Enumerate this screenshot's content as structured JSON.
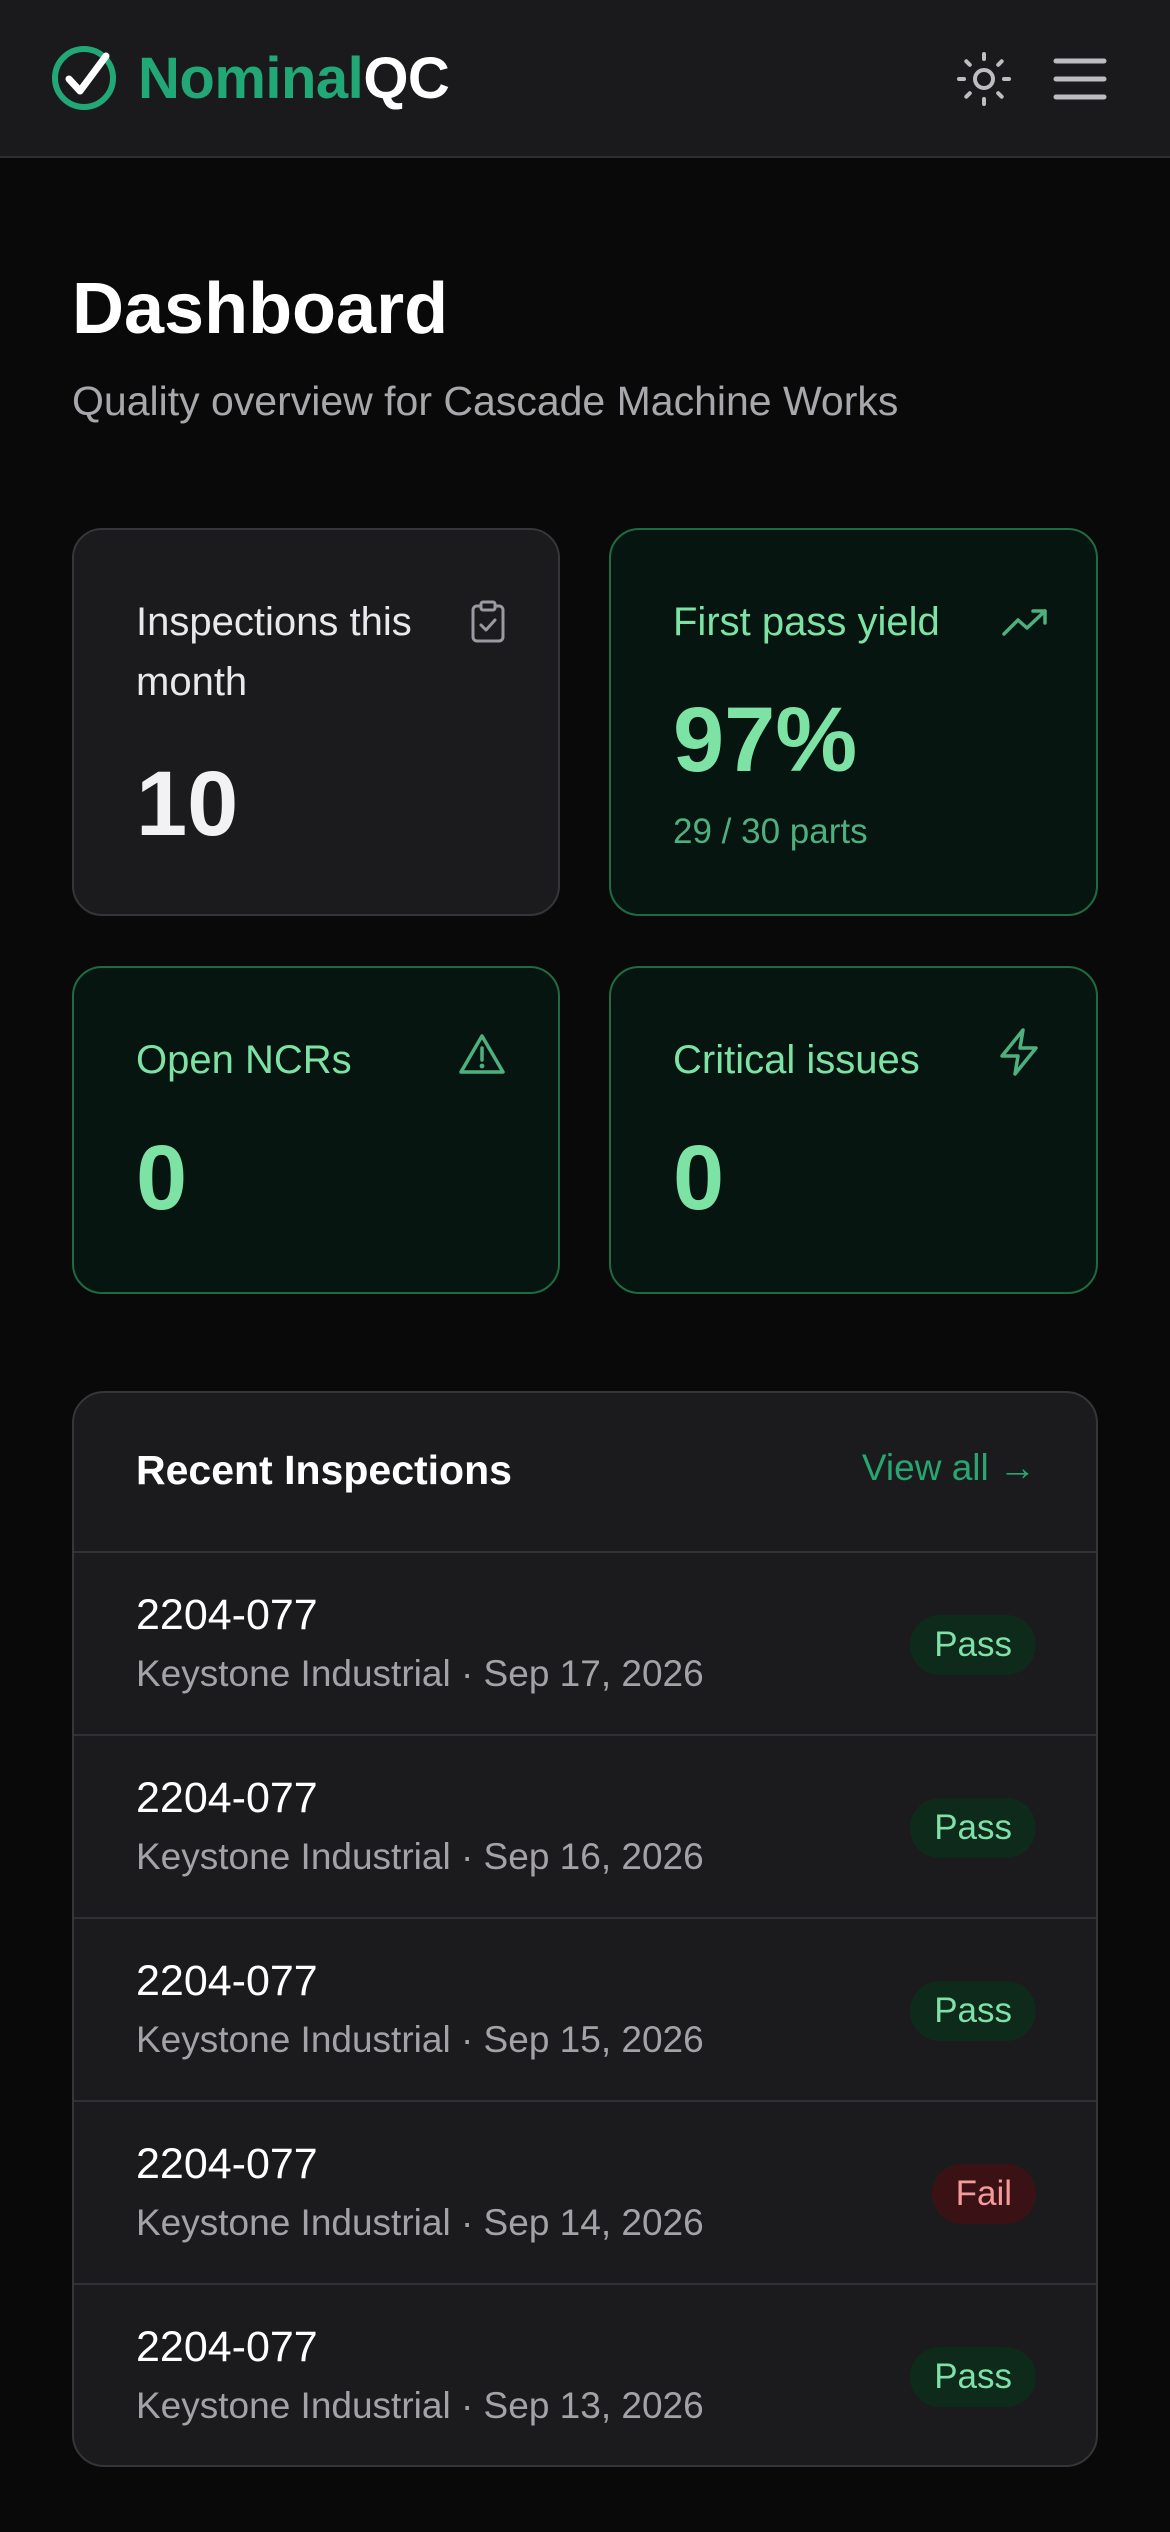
{
  "header": {
    "brand": "Nominal",
    "brand_suffix": "QC",
    "icons": {
      "logo": "check-circle-icon",
      "theme": "sun-icon",
      "menu": "hamburger-menu-icon"
    }
  },
  "page": {
    "title": "Dashboard",
    "subtitle": "Quality overview for Cascade Machine Works"
  },
  "stats": {
    "inspections": {
      "label": "Inspections this month",
      "value": "10",
      "icon": "clipboard-check-icon"
    },
    "yield": {
      "label": "First pass yield",
      "value": "97%",
      "sub": "29 / 30 parts",
      "icon": "trending-up-icon"
    },
    "ncrs": {
      "label": "Open NCRs",
      "value": "0",
      "icon": "alert-triangle-icon"
    },
    "critical": {
      "label": "Critical issues",
      "value": "0",
      "icon": "lightning-icon"
    }
  },
  "recent": {
    "title": "Recent Inspections",
    "view_all": "View all →",
    "rows": [
      {
        "id": "2204-077",
        "meta": "Keystone Industrial · Sep 17, 2026",
        "status": "Pass"
      },
      {
        "id": "2204-077",
        "meta": "Keystone Industrial · Sep 16, 2026",
        "status": "Pass"
      },
      {
        "id": "2204-077",
        "meta": "Keystone Industrial · Sep 15, 2026",
        "status": "Pass"
      },
      {
        "id": "2204-077",
        "meta": "Keystone Industrial · Sep 14, 2026",
        "status": "Fail"
      },
      {
        "id": "2204-077",
        "meta": "Keystone Industrial · Sep 13, 2026",
        "status": "Pass"
      }
    ]
  },
  "colors": {
    "accent": "#22a876",
    "accent_light": "#7ce3a5",
    "background": "#09090a",
    "card": "#1b1b1d",
    "pass_bg": "#0e2a1b",
    "fail_bg": "#3a1215"
  }
}
